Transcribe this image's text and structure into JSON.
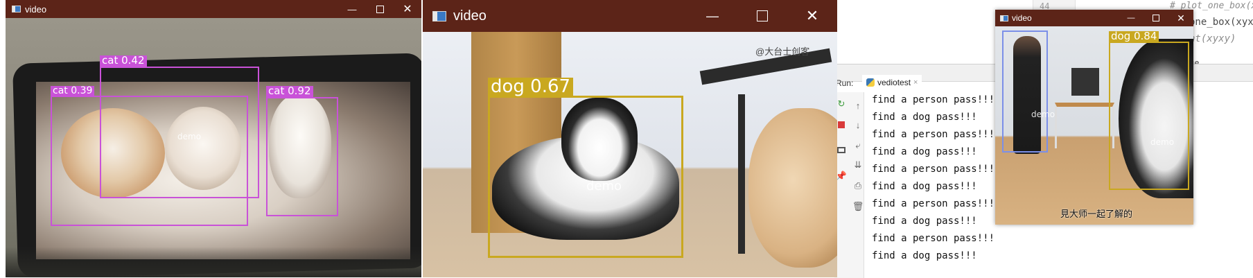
{
  "window1": {
    "title": "video",
    "detections": [
      {
        "label": "cat 0.42"
      },
      {
        "label": "cat 0.39"
      },
      {
        "label": "cat 0.92"
      }
    ],
    "watermark": "demo"
  },
  "window2": {
    "title": "video",
    "detections": [
      {
        "label": "dog 0.67"
      }
    ],
    "watermark": "demo",
    "overlay_text": "@大台士创客"
  },
  "window3": {
    "title": "video",
    "detections": [
      {
        "label": "dog 0.84"
      }
    ],
    "watermark_left": "demo",
    "watermark_right": "demo",
    "subtitle": "見大师一起了解的"
  },
  "ide": {
    "line_number": "44",
    "code_lines": [
      "# plot_one_box(xyxy,",
      "one_box(xyxy",
      "nt(xyxy)",
      "ue"
    ],
    "run_label": "Run:",
    "run_tab": "vediotest",
    "output_lines": [
      "find a  person  pass!!!",
      "find a  dog  pass!!!",
      "find a  person  pass!!!",
      "find a  dog  pass!!!",
      "find a  person  pass!!!",
      "find a  dog  pass!!!",
      "find a  person  pass!!!",
      "find a  dog  pass!!!",
      "find a  person  pass!!!",
      "find a  dog  pass!!!"
    ]
  },
  "colors": {
    "titlebar_brown": "#5c2418",
    "box_magenta": "#c952d8",
    "box_gold": "#c9a820",
    "box_blue": "#7b8fe8"
  }
}
